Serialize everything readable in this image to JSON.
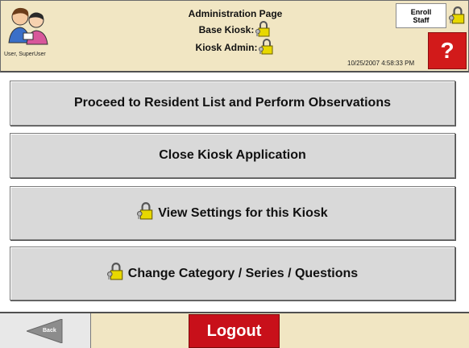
{
  "header": {
    "user_label": "User, SuperUser",
    "title": "Administration Page",
    "base_kiosk_label": "Base Kiosk:",
    "kiosk_admin_label": "Kiosk Admin:",
    "timestamp": "10/25/2007 4:58:33 PM",
    "enroll_staff_label": "Enroll\nStaff",
    "help_label": "?"
  },
  "actions": [
    {
      "label": "Proceed to Resident List and Perform Observations",
      "locked": false
    },
    {
      "label": "Close Kiosk Application",
      "locked": false
    },
    {
      "label": "View Settings for this Kiosk",
      "locked": true
    },
    {
      "label": "Change Category / Series / Questions",
      "locked": true
    }
  ],
  "footer": {
    "back_label": "Back",
    "logout_label": "Logout"
  },
  "colors": {
    "header_bg": "#f1e6c3",
    "button_bg": "#d9d9d9",
    "help_red": "#d21a1a",
    "logout_red": "#c8101a",
    "lock_yellow": "#e8d800"
  },
  "icons": {
    "avatar": "users-avatar-icon",
    "lock": "padlock-keys-icon",
    "back": "back-arrow-icon"
  }
}
